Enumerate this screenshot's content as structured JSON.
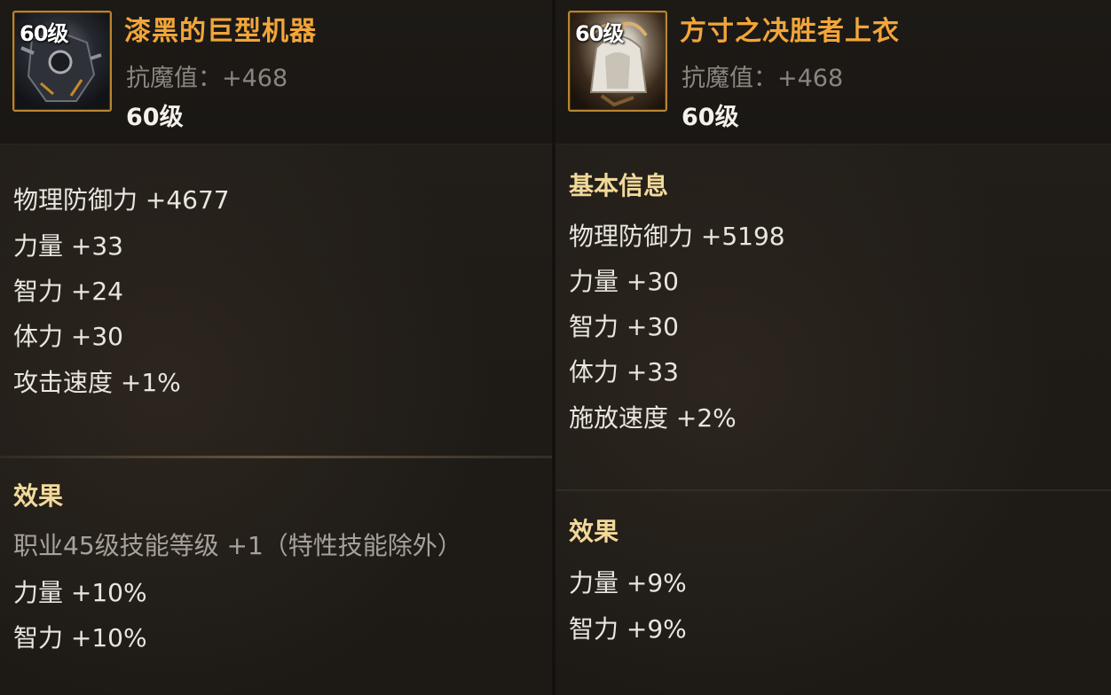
{
  "items": [
    {
      "icon_level": "60级",
      "name": "漆黑的巨型机器",
      "magic_resist": "抗魔值：+468",
      "required_level": "60级",
      "basic_title": "",
      "stats": [
        "物理防御力 +4677",
        "力量 +33",
        "智力 +24",
        "体力 +30",
        "攻击速度 +1%"
      ],
      "effect_title": "效果",
      "effects": [
        "职业45级技能等级 +1（特性技能除外）",
        "力量 +10%",
        "智力 +10%"
      ]
    },
    {
      "icon_level": "60级",
      "name": "方寸之决胜者上衣",
      "magic_resist": "抗魔值：+468",
      "required_level": "60级",
      "basic_title": "基本信息",
      "stats": [
        "物理防御力 +5198",
        "力量 +30",
        "智力 +30",
        "体力 +33",
        "施放速度 +2%"
      ],
      "effect_title": "效果",
      "effects": [
        "力量 +9%",
        "智力 +9%"
      ]
    }
  ],
  "colors": {
    "item_name": "#f2a53a",
    "section_title": "#f2d99a",
    "stat_text": "#e9e6df",
    "muted_text": "#a6a29a",
    "icon_border": "#b8852f",
    "background": "#1c1915"
  },
  "icons": [
    "armor-mech-icon",
    "armor-coat-icon"
  ]
}
